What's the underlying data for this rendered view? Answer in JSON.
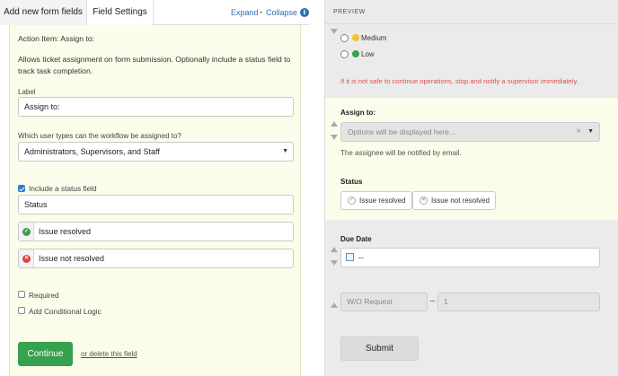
{
  "tabs": {
    "add_fields": "Add new form fields",
    "field_settings": "Field Settings",
    "expand": "Expand",
    "separator": "•",
    "collapse": "Collapse",
    "info": "i"
  },
  "settings": {
    "title": "Action Item: Assign to:",
    "description": "Allows ticket assignment on form submission. Optionally include a status field to track task completion.",
    "label_caption": "Label",
    "label_value": "Assign to:",
    "user_types_question": "Which user types can the workflow be assigned to?",
    "user_types_selected": "Administrators, Supervisors, and Staff",
    "include_status_label": "Include a status field",
    "include_status_checked": true,
    "status_field_name": "Status",
    "status_options": [
      {
        "label": "Issue resolved",
        "icon": "check-circle-icon",
        "color": "#3aa04e"
      },
      {
        "label": "Issue not resolved",
        "icon": "x-circle-icon",
        "color": "#d64541"
      }
    ],
    "required_label": "Required",
    "required_checked": false,
    "conditional_label": "Add Conditional Logic",
    "conditional_checked": false,
    "continue_label": "Continue",
    "delete_label": "or delete this field"
  },
  "preview": {
    "header": "PREVIEW",
    "priority_options": [
      {
        "label": "Medium",
        "color": "#f4c430"
      },
      {
        "label": "Low",
        "color": "#3aa04e"
      }
    ],
    "warning": "If it is not safe to continue operations, stop and notify a supervisor immediately.",
    "assign_title": "Assign to:",
    "assign_placeholder": "Options will be displayed here...",
    "assign_clear": "×",
    "assign_note": "The assignee will be notified by email.",
    "status_title": "Status",
    "status_options": [
      "Issue resolved",
      "Issue not resolved"
    ],
    "due_date_title": "Due Date",
    "due_date_value": "--",
    "wo_placeholder": "W/O Request",
    "wo_dash": "–",
    "wo_number": "1",
    "submit_label": "Submit"
  }
}
